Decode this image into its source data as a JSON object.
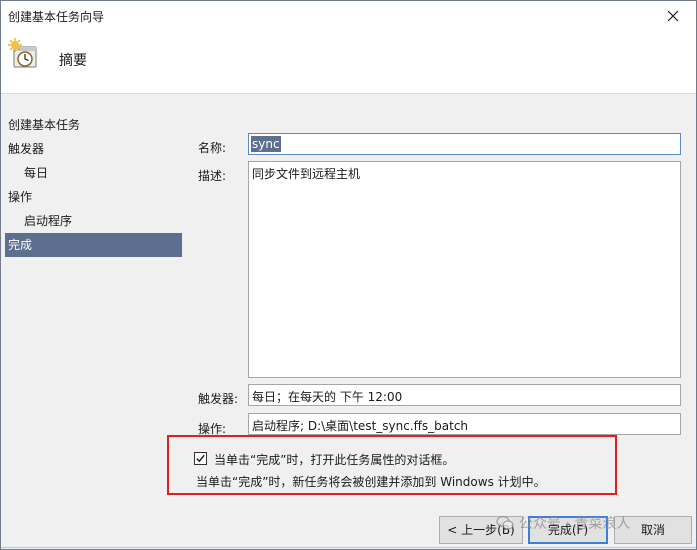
{
  "window": {
    "title": "创建基本任务向导",
    "close_icon": "close-icon"
  },
  "header": {
    "title": "摘要",
    "icon": "task-clock-icon"
  },
  "nav": {
    "items": [
      {
        "label": "创建基本任务",
        "level": 1,
        "selected": false
      },
      {
        "label": "触发器",
        "level": 1,
        "selected": false
      },
      {
        "label": "每日",
        "level": 2,
        "selected": false
      },
      {
        "label": "操作",
        "level": 1,
        "selected": false
      },
      {
        "label": "启动程序",
        "level": 2,
        "selected": false
      },
      {
        "label": "完成",
        "level": 1,
        "selected": true
      }
    ]
  },
  "form": {
    "name_label": "名称:",
    "name_value": "sync",
    "desc_label": "描述:",
    "desc_value": "同步文件到远程主机",
    "trigger_label": "触发器:",
    "trigger_value": "每日；在每天的 下午 12:00",
    "action_label": "操作:",
    "action_value": "启动程序; D:\\桌面\\test_sync.ffs_batch"
  },
  "notice": {
    "checkbox_checked": true,
    "checkbox_label": "当单击“完成”时，打开此任务属性的对话框。",
    "info": "当单击“完成”时，新任务将会被创建并添加到 Windows 计划中。"
  },
  "buttons": {
    "back": "< 上一步(B)",
    "finish": "完成(F)",
    "cancel": "取消"
  },
  "watermark": {
    "text": "公众号 · 青菜浪人",
    "icon": "wechat-icon"
  }
}
